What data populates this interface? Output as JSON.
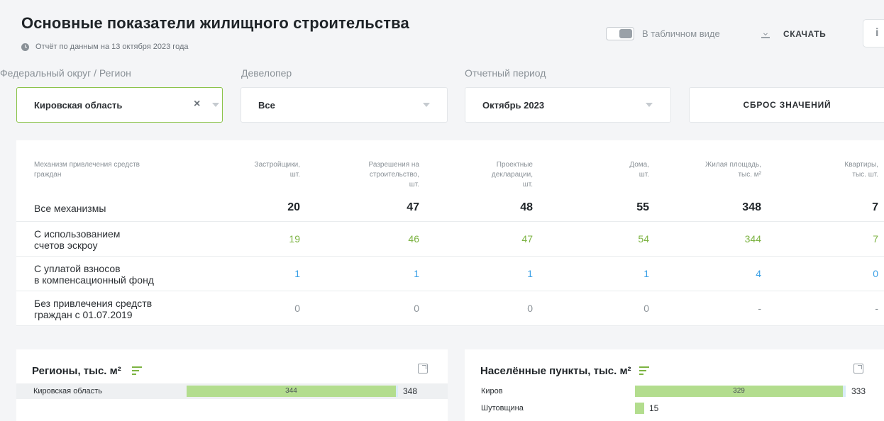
{
  "header": {
    "title": "Основные показатели жилищного строительства",
    "report_date": "Отчёт по данным на 13 октября 2023 года",
    "table_view_label": "В табличном виде",
    "download_label": "СКАЧАТЬ",
    "info_label": "i"
  },
  "filters": {
    "region": {
      "label": "Федеральный округ / Регион",
      "value": "Кировская область",
      "clear": "×"
    },
    "developer": {
      "label": "Девелопер",
      "value": "Все"
    },
    "period": {
      "label": "Отчетный период",
      "value": "Октябрь 2023"
    },
    "reset_label": "СБРОС ЗНАЧЕНИЙ"
  },
  "table": {
    "headers": [
      "Механизм привлечения средств граждан",
      "Застройщики, шт.",
      "Разрешения на строительство, шт.",
      "Проектные декларации, шт.",
      "Дома, шт.",
      "Жилая площадь, тыс. м²",
      "Квартиры, тыс. шт."
    ],
    "header_lines": [
      [
        "Механизм привлечения средств",
        "граждан"
      ],
      [
        "Застройщики,",
        "шт."
      ],
      [
        "Разрешения на",
        "строительство,",
        "шт."
      ],
      [
        "Проектные",
        "декларации,",
        "шт."
      ],
      [
        "Дома,",
        "шт."
      ],
      [
        "Жилая площадь,",
        "тыс. м²"
      ],
      [
        "Квартиры,",
        "тыс. шт."
      ]
    ],
    "rows": [
      {
        "label_lines": [
          "Все механизмы"
        ],
        "values": [
          "20",
          "47",
          "48",
          "55",
          "348",
          "7"
        ]
      },
      {
        "label_lines": [
          "С использованием",
          "счетов эскроу"
        ],
        "values": [
          "19",
          "46",
          "47",
          "54",
          "344",
          "7"
        ]
      },
      {
        "label_lines": [
          "С уплатой взносов",
          "в компенсационный фонд"
        ],
        "values": [
          "1",
          "1",
          "1",
          "1",
          "4",
          "0"
        ]
      },
      {
        "label_lines": [
          "Без привлечения средств",
          "граждан с 01.07.2019"
        ],
        "values": [
          "0",
          "0",
          "0",
          "0",
          "-",
          "-"
        ]
      }
    ]
  },
  "regions_card": {
    "title": "Регионы, тыс. м²",
    "bars": [
      {
        "label": "Кировская область",
        "value": 344,
        "total": 348
      }
    ]
  },
  "settlements_card": {
    "title": "Населённые пункты, тыс. м²",
    "bars": [
      {
        "label": "Киров",
        "value": 329,
        "total": 333
      },
      {
        "label": "Шутовщина",
        "value": 15,
        "total": null
      }
    ]
  },
  "colors": {
    "accent_green": "#7cb342",
    "bar_green": "#b3dd8e",
    "link_blue": "#3aa0e6"
  }
}
